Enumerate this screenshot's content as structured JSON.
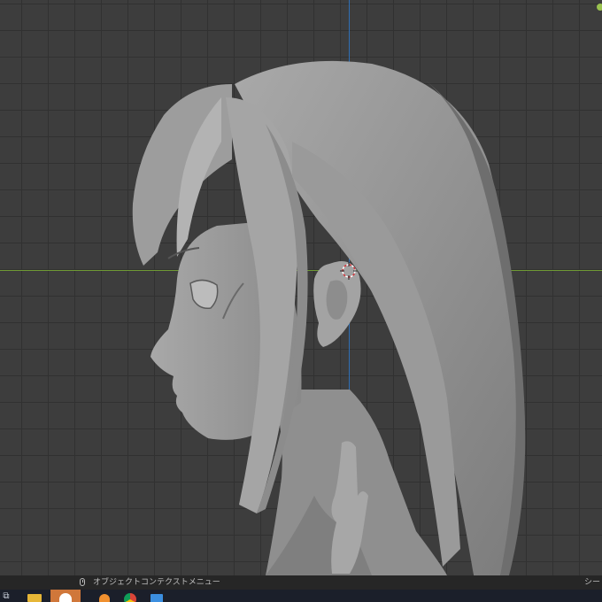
{
  "viewport": {
    "object": "head-sculpt-mesh",
    "colors": {
      "grid_bg": "#3d3d3d",
      "y_axis": "#2f6fb5",
      "x_axis": "#6f9a35"
    }
  },
  "statusbar": {
    "hint": "オブジェクトコンテクストメニュー",
    "right": "シー"
  },
  "taskbar": {
    "start_glyph": "⧉",
    "icons": [
      "start-icon",
      "file-explorer-icon",
      "active-app-icon",
      "blender-icon",
      "chrome-icon",
      "app-icon"
    ]
  }
}
